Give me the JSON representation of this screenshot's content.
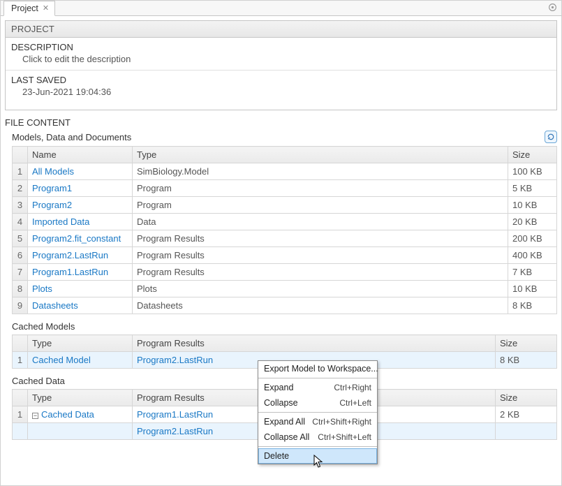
{
  "tab": {
    "label": "Project"
  },
  "project": {
    "header": "PROJECT",
    "description_label": "DESCRIPTION",
    "description_value": "Click to edit the description",
    "lastsaved_label": "LAST SAVED",
    "lastsaved_value": "23-Jun-2021 19:04:36"
  },
  "filecontent": {
    "label": "FILE CONTENT",
    "models_title": "Models, Data and Documents",
    "headers": {
      "name": "Name",
      "type": "Type",
      "size": "Size"
    },
    "rows": [
      {
        "n": "1",
        "name": "All Models",
        "type": "SimBiology.Model",
        "size": "100 KB"
      },
      {
        "n": "2",
        "name": "Program1",
        "type": "Program",
        "size": "5 KB"
      },
      {
        "n": "3",
        "name": "Program2",
        "type": "Program",
        "size": "10 KB"
      },
      {
        "n": "4",
        "name": "Imported Data",
        "type": "Data",
        "size": "20 KB"
      },
      {
        "n": "5",
        "name": "Program2.fit_constant",
        "type": "Program Results",
        "size": "200 KB"
      },
      {
        "n": "6",
        "name": "Program2.LastRun",
        "type": "Program Results",
        "size": "400 KB"
      },
      {
        "n": "7",
        "name": "Program1.LastRun",
        "type": "Program Results",
        "size": "7 KB"
      },
      {
        "n": "8",
        "name": "Plots",
        "type": "Plots",
        "size": "10 KB"
      },
      {
        "n": "9",
        "name": "Datasheets",
        "type": "Datasheets",
        "size": "8 KB"
      }
    ]
  },
  "cached_models": {
    "title": "Cached Models",
    "headers": {
      "type": "Type",
      "pr": "Program Results",
      "size": "Size"
    },
    "rows": [
      {
        "n": "1",
        "type": "Cached Model",
        "pr": "Program2.LastRun",
        "size": "8 KB"
      }
    ]
  },
  "cached_data": {
    "title": "Cached Data",
    "headers": {
      "type": "Type",
      "pr": "Program Results",
      "size": "Size"
    },
    "rows": [
      {
        "n": "1",
        "type": "Cached Data",
        "pr": "Program1.LastRun",
        "size": "2 KB"
      },
      {
        "n": "",
        "type": "",
        "pr": "Program2.LastRun",
        "size": ""
      }
    ]
  },
  "ctx": {
    "export": "Export Model to Workspace...",
    "expand": "Expand",
    "collapse": "Collapse",
    "expand_all": "Expand All",
    "collapse_all": "Collapse All",
    "delete": "Delete",
    "sc_expand": "Ctrl+Right",
    "sc_collapse": "Ctrl+Left",
    "sc_expand_all": "Ctrl+Shift+Right",
    "sc_collapse_all": "Ctrl+Shift+Left"
  }
}
